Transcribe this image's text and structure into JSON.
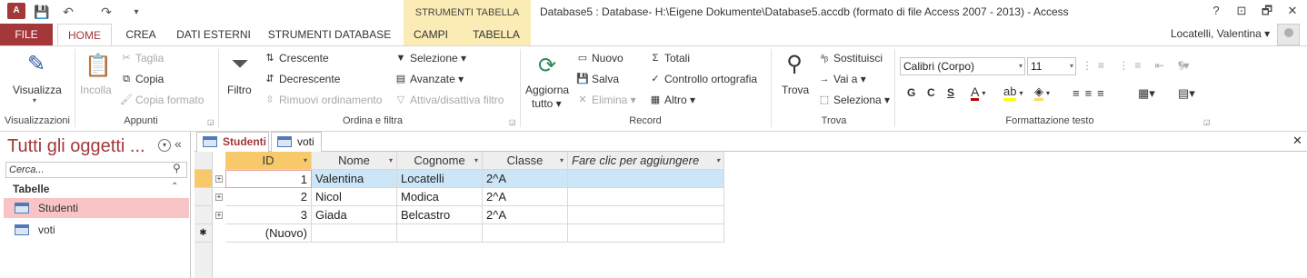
{
  "app": {
    "icon_label": "A",
    "context_header": "STRUMENTI TABELLA",
    "doc_title": "Database5 : Database- H:\\Eigene Dokumente\\Database5.accdb (formato di file Access 2007 - 2013) - Access",
    "user": "Locatelli, Valentina ▾",
    "win_help": "?",
    "win_restore_ribbon": "⊡",
    "win_restore": "🗗",
    "win_close": "✕"
  },
  "qat": {
    "save_icon": "💾",
    "undo": "↶",
    "redo": "↷",
    "customize": "▾"
  },
  "tabs": [
    {
      "label": "FILE"
    },
    {
      "label": "HOME"
    },
    {
      "label": "CREA"
    },
    {
      "label": "DATI ESTERNI"
    },
    {
      "label": "STRUMENTI DATABASE"
    },
    {
      "label": "CAMPI"
    },
    {
      "label": "TABELLA"
    }
  ],
  "ribbon": {
    "groups": {
      "visualizzazioni": "Visualizzazioni",
      "appunti": "Appunti",
      "ordina": "Ordina e filtra",
      "record": "Record",
      "trova": "Trova",
      "formattazione": "Formattazione testo"
    },
    "visualizza": "Visualizza",
    "incolla": "Incolla",
    "taglia": "Taglia",
    "copia": "Copia",
    "copia_formato": "Copia formato",
    "filtro": "Filtro",
    "crescente": "Crescente",
    "decrescente": "Decrescente",
    "rimuovi_ordinamento": "Rimuovi ordinamento",
    "selezione": "Selezione ▾",
    "avanzate": "Avanzate ▾",
    "attiva_filtro": "Attiva/disattiva filtro",
    "aggiorna": "Aggiorna",
    "aggiorna2": "tutto ▾",
    "nuovo": "Nuovo",
    "salva": "Salva",
    "elimina": "Elimina ▾",
    "totali": "Totali",
    "controllo": "Controllo ortografia",
    "altro": "Altro ▾",
    "trova_btn": "Trova",
    "sostituisci": "Sostituisci",
    "vai_a": "Vai a ▾",
    "seleziona": "Seleziona ▾",
    "font": "Calibri (Corpo)",
    "font_size": "11",
    "bold": "G",
    "italic": "C",
    "underline": "S"
  },
  "nav": {
    "title": "Tutti gli oggetti ...",
    "search_placeholder": "Cerca...",
    "section": "Tabelle",
    "items": [
      {
        "label": "Studenti"
      },
      {
        "label": "voti"
      }
    ]
  },
  "doctabs": [
    {
      "label": "Studenti"
    },
    {
      "label": "voti"
    }
  ],
  "table": {
    "columns": [
      "ID",
      "Nome",
      "Cognome",
      "Classe",
      "Fare clic per aggiungere"
    ],
    "rows": [
      {
        "id": "1",
        "nome": "Valentina",
        "cognome": "Locatelli",
        "classe": "2^A"
      },
      {
        "id": "2",
        "nome": "Nicol",
        "cognome": "Modica",
        "classe": "2^A"
      },
      {
        "id": "3",
        "nome": "Giada",
        "cognome": "Belcastro",
        "classe": "2^A"
      }
    ],
    "new_row": "(Nuovo)",
    "new_marker": "✱"
  },
  "colors": {
    "accent": "#a4373a",
    "context": "#fbecb5",
    "selected_nav": "#f8c4c6",
    "selected_row": "#cde6f7"
  }
}
